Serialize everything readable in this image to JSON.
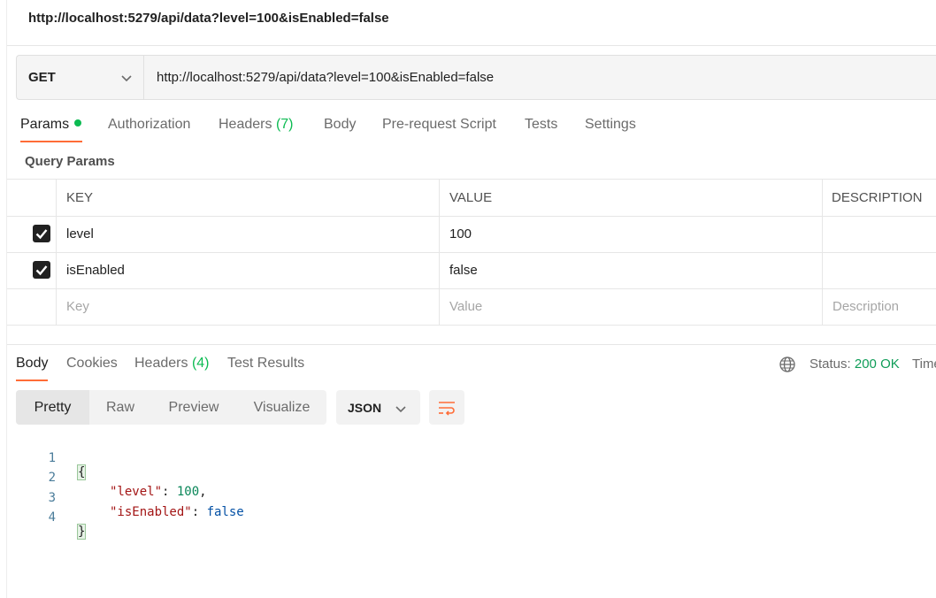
{
  "request_title": "http://localhost:5279/api/data?level=100&isEnabled=false",
  "request": {
    "method": "GET",
    "url": "http://localhost:5279/api/data?level=100&isEnabled=false"
  },
  "tabs": {
    "params": "Params",
    "authorization": "Authorization",
    "headers": "Headers",
    "headers_count": "(7)",
    "body": "Body",
    "pre_request": "Pre-request Script",
    "tests": "Tests",
    "settings": "Settings"
  },
  "query_params": {
    "label": "Query Params",
    "columns": {
      "key": "KEY",
      "value": "VALUE",
      "description": "DESCRIPTION"
    },
    "rows": [
      {
        "key": "level",
        "value": "100",
        "checked": true
      },
      {
        "key": "isEnabled",
        "value": "false",
        "checked": true
      }
    ],
    "placeholders": {
      "key": "Key",
      "value": "Value",
      "description": "Description"
    }
  },
  "response": {
    "tabs": {
      "body": "Body",
      "cookies": "Cookies",
      "headers": "Headers",
      "headers_count": "(4)",
      "test_results": "Test Results"
    },
    "status_label": "Status:",
    "status_value": "200 OK",
    "time_label": "Time",
    "view_modes": [
      "Pretty",
      "Raw",
      "Preview",
      "Visualize"
    ],
    "format": "JSON",
    "code": {
      "line_numbers": [
        "1",
        "2",
        "3",
        "4"
      ],
      "open_brace": "{",
      "close_brace": "}",
      "key1": "\"level\"",
      "val1": "100",
      "key2": "\"isEnabled\"",
      "val2": "false",
      "colon": ": ",
      "comma": ","
    }
  },
  "colors": {
    "accent": "#ff6c37",
    "success": "#0cbb52",
    "status_ok": "#0f9d58"
  }
}
